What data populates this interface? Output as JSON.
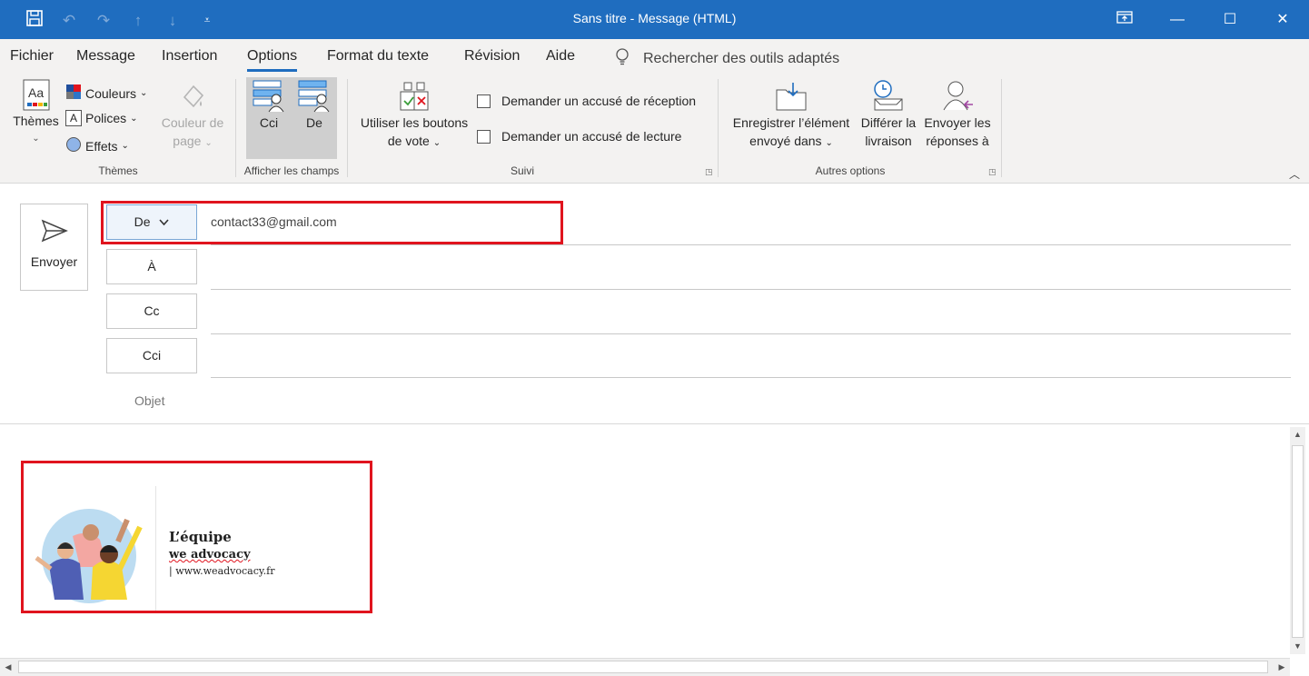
{
  "window": {
    "title": "Sans titre  -  Message (HTML)",
    "controls": [
      "restore-ribbon",
      "minimize",
      "maximize",
      "close"
    ]
  },
  "qat": {
    "icons": [
      "save-icon",
      "undo-icon",
      "redo-icon",
      "up-arrow-icon",
      "down-arrow-icon",
      "customize-icon"
    ]
  },
  "menu": {
    "tabs": [
      "Fichier",
      "Message",
      "Insertion",
      "Options",
      "Format du texte",
      "Révision",
      "Aide"
    ],
    "active_tab": "Options",
    "search_hint": "Rechercher des outils adaptés"
  },
  "ribbon": {
    "themes": {
      "themes_label": "Thèmes",
      "colors_label": "Couleurs",
      "fonts_label": "Polices",
      "effects_label": "Effets",
      "page_color_line1": "Couleur de",
      "page_color_line2": "page",
      "group_label": "Thèmes"
    },
    "fields": {
      "bcc_label": "Cci",
      "from_label": "De",
      "group_label": "Afficher les champs"
    },
    "tracking": {
      "vote_line1": "Utiliser les boutons",
      "vote_line2": "de vote",
      "delivery_receipt": "Demander un accusé de réception",
      "read_receipt": "Demander un accusé de lecture",
      "group_label": "Suivi"
    },
    "more": {
      "save_sent_line1": "Enregistrer l’élément",
      "save_sent_line2": "envoyé dans",
      "delay_line1": "Différer la",
      "delay_line2": "livraison",
      "reply_to_line1": "Envoyer les",
      "reply_to_line2": "réponses à",
      "group_label": "Autres options"
    }
  },
  "compose": {
    "send_label": "Envoyer",
    "from_button": "De",
    "from_value": "contact33@gmail.com",
    "to_button": "À",
    "cc_button": "Cc",
    "bcc_button": "Cci",
    "subject_label": "Objet"
  },
  "signature": {
    "name": "L’équipe",
    "team": "we advocacy",
    "url": "| www.weadvocacy.fr"
  },
  "colors": {
    "titlebar": "#1f6dbf",
    "highlight": "#e0141e",
    "ribbon_bg": "#f3f2f1"
  }
}
